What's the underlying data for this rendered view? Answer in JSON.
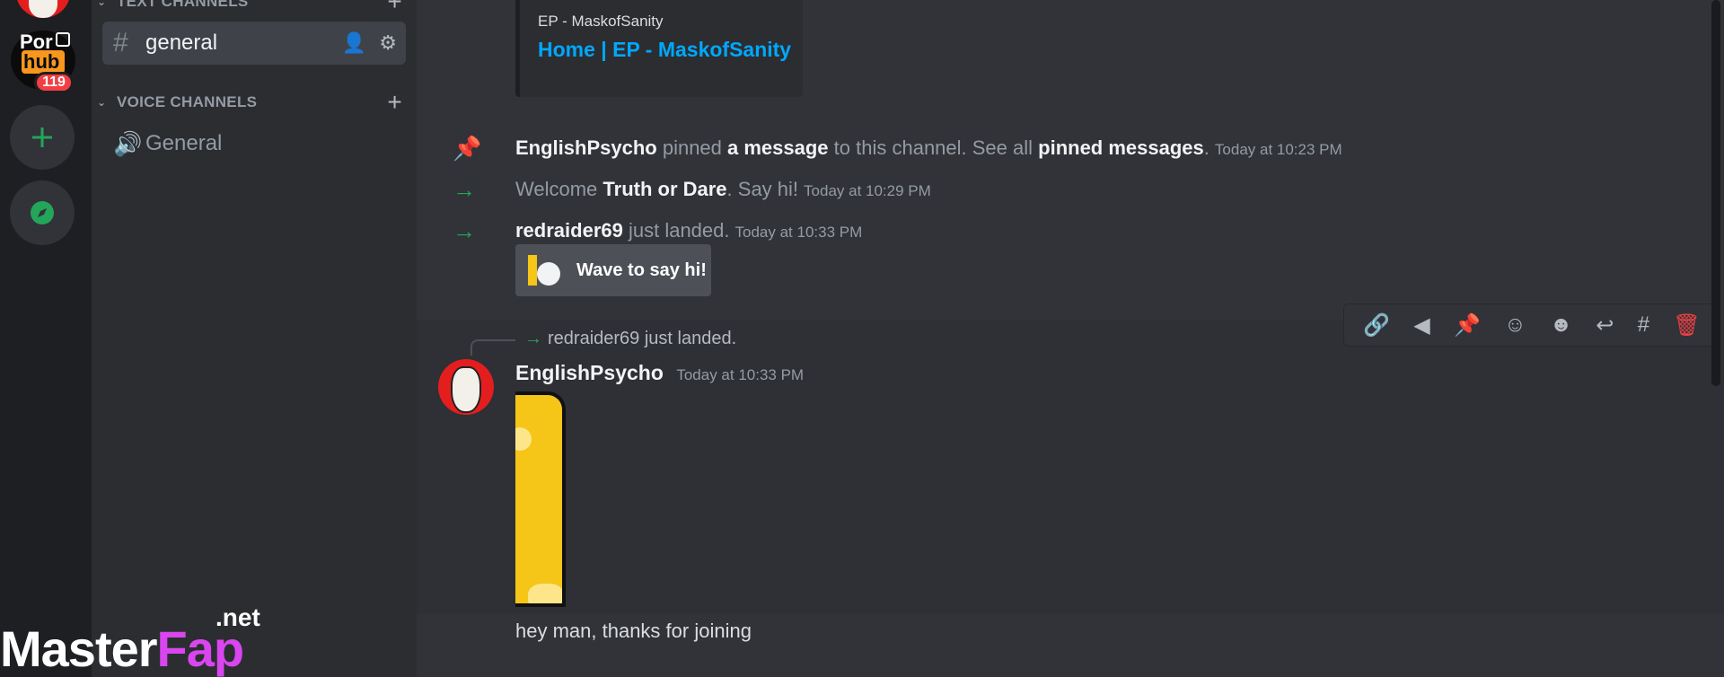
{
  "servers": {
    "server_badge": "119",
    "server_label_top": "Por",
    "server_label_mid": "hub"
  },
  "channels": {
    "text_category": "TEXT CHANNELS",
    "voice_category": "VOICE CHANNELS",
    "text_channels": [
      {
        "name": "general",
        "active": true
      }
    ],
    "voice_channels": [
      {
        "name": "General"
      }
    ]
  },
  "chat": {
    "embed": {
      "provider": "EP - MaskofSanity",
      "title": "Home | EP - MaskofSanity"
    },
    "system_messages": [
      {
        "icon": "pin-icon",
        "actor": "EnglishPsycho",
        "text1": " pinned ",
        "link1": "a message",
        "text2": " to this channel. See all ",
        "link2": "pinned messages",
        "text3": ".",
        "timestamp": "Today at 10:23 PM"
      },
      {
        "icon": "join-arrow-icon",
        "prefix": "Welcome ",
        "actor": "Truth or Dare",
        "suffix": ". Say hi!",
        "timestamp": "Today at 10:29 PM"
      },
      {
        "icon": "join-arrow-icon",
        "actor": "redraider69",
        "suffix": " just landed.",
        "timestamp": "Today at 10:33 PM"
      }
    ],
    "wave_button": "Wave to say hi!",
    "reply_context": "redraider69 just landed.",
    "message": {
      "author": "EnglishPsycho",
      "timestamp": "Today at 10:33 PM",
      "text": "hey man, thanks for joining"
    },
    "toolbar_icons": [
      "link-icon",
      "tag-icon",
      "pin-icon",
      "add-reaction-icon",
      "super-reaction-icon",
      "reply-icon",
      "create-thread-icon",
      "trash-icon"
    ]
  },
  "watermark": {
    "brand_a": "Master",
    "brand_b": "Fap",
    "suffix": ".net"
  },
  "colors": {
    "accent_green": "#23a55a",
    "link_blue": "#00a8fc",
    "danger_red": "#f23f43",
    "bg_main": "#313338"
  }
}
